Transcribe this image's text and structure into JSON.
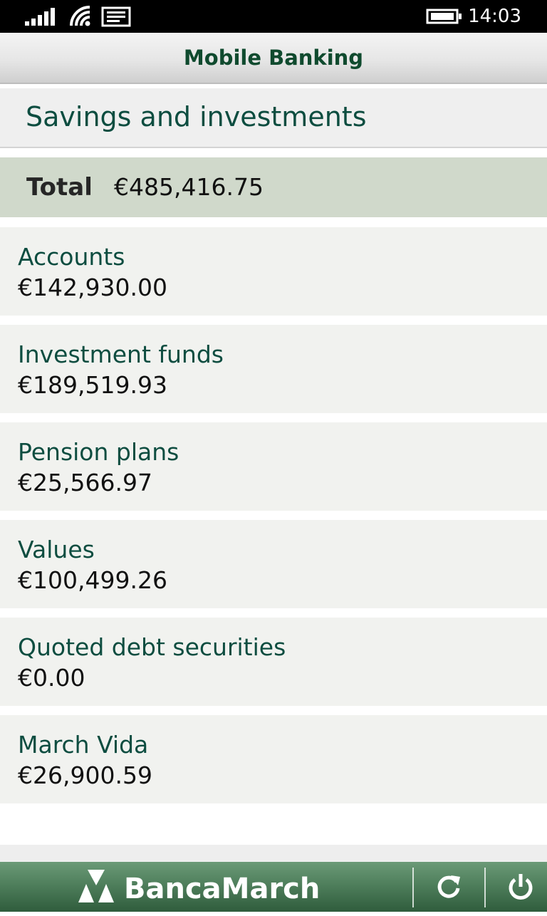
{
  "status_bar": {
    "time": "14:03",
    "icons": [
      "signal-icon",
      "wifi-icon",
      "message-icon",
      "battery-icon"
    ]
  },
  "header": {
    "title": "Mobile Banking"
  },
  "section": {
    "title": "Savings and investments"
  },
  "total": {
    "label": "Total",
    "value": "€485,416.75"
  },
  "items": [
    {
      "name": "Accounts",
      "value": "€142,930.00"
    },
    {
      "name": "Investment funds",
      "value": "€189,519.93"
    },
    {
      "name": "Pension plans",
      "value": "€25,566.97"
    },
    {
      "name": "Values",
      "value": "€100,499.26"
    },
    {
      "name": "Quoted debt securities",
      "value": "€0.00"
    },
    {
      "name": "March Vida",
      "value": "€26,900.59"
    }
  ],
  "app_bar": {
    "brand": "BancaMarch",
    "logo_icon": "banca-march-logo-icon",
    "buttons": [
      "refresh-icon",
      "power-icon"
    ]
  },
  "colors": {
    "title_green": "#0f4a2e",
    "item_name_teal": "#0d4d40",
    "total_background": "#d0d9cb",
    "item_background": "#f1f2ef",
    "app_bar_green": "#4f7f5c"
  }
}
